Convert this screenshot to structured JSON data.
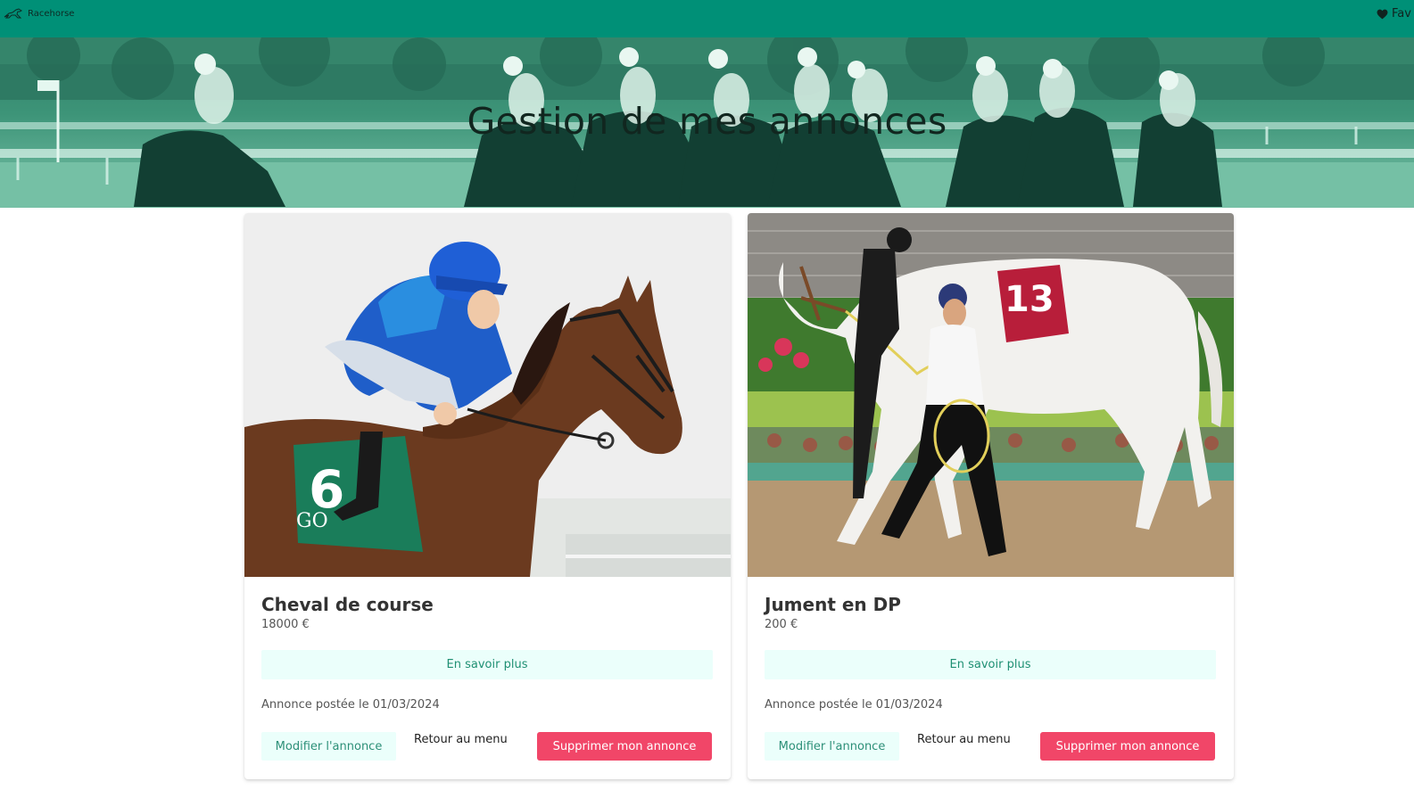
{
  "navbar": {
    "brand_label": "Racehorse",
    "favorites_label": "Fav",
    "icons": {
      "brand": "horse-logo-icon",
      "favorites": "heart-icon"
    }
  },
  "hero": {
    "title": "Gestion de mes annonces"
  },
  "listings": [
    {
      "title": "Cheval de course",
      "price": "18000 €",
      "more_label": "En savoir plus",
      "posted": "Annonce postée le 01/03/2024",
      "edit_label": "Modifier l'annonce",
      "back_label": "Retour au menu",
      "delete_label": "Supprimer mon annonce",
      "photo_saddle_number": "6",
      "photo_cloth_text": "GO"
    },
    {
      "title": "Jument en DP",
      "price": "200 €",
      "more_label": "En savoir plus",
      "posted": "Annonce postée le 01/03/2024",
      "edit_label": "Modifier l'annonce",
      "back_label": "Retour au menu",
      "delete_label": "Supprimer mon annonce",
      "photo_saddle_number": "13"
    }
  ],
  "colors": {
    "navbar": "#009077",
    "primary_light": "#ebfffb",
    "primary_text": "#1f8f73",
    "danger": "#f14668"
  }
}
